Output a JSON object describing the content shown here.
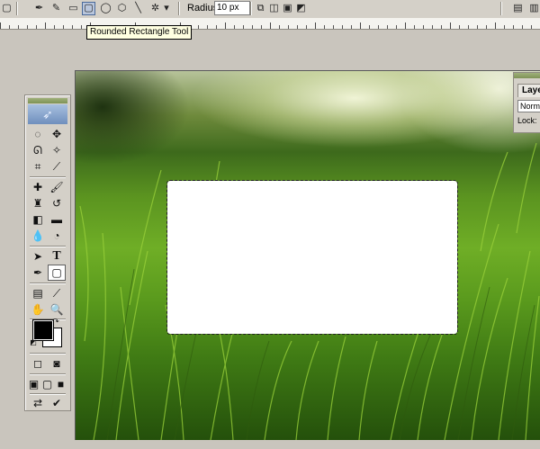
{
  "options_bar": {
    "radius_label": "Radius:",
    "radius_value": "10 px",
    "tool_icons": [
      "rectangle-icon",
      "pen-icon",
      "freeform-pen-icon",
      "rectangle-shape-icon",
      "rounded-rectangle-icon",
      "ellipse-icon",
      "polygon-icon",
      "line-icon",
      "custom-shape-icon"
    ],
    "combine_modes": [
      "add-icon",
      "subtract-icon",
      "intersect-icon",
      "exclude-icon"
    ]
  },
  "tooltip": {
    "text": "Rounded Rectangle Tool"
  },
  "layers_panel": {
    "tab_label": "Layer",
    "blend_mode": "Norma",
    "lock_label": "Lock:"
  },
  "toolbox": {
    "tools": [
      "marquee-icon",
      "move-icon",
      "lasso-icon",
      "magic-wand-icon",
      "crop-icon",
      "slice-icon",
      "healing-brush-icon",
      "brush-icon",
      "clone-stamp-icon",
      "history-brush-icon",
      "eraser-icon",
      "gradient-icon",
      "blur-icon",
      "dodge-icon",
      "path-selection-icon",
      "type-icon",
      "pen-tool-icon",
      "rounded-rectangle-tool-icon",
      "notes-icon",
      "eyedropper-icon",
      "hand-icon",
      "zoom-icon"
    ],
    "selected_tool": "rounded-rectangle-tool-icon",
    "foreground_color": "#000000",
    "background_color": "#ffffff"
  },
  "colors": {
    "ui_gray": "#d4d0c8",
    "selection_highlight": "#b9c6dc",
    "shape_fill": "#ffffff"
  }
}
